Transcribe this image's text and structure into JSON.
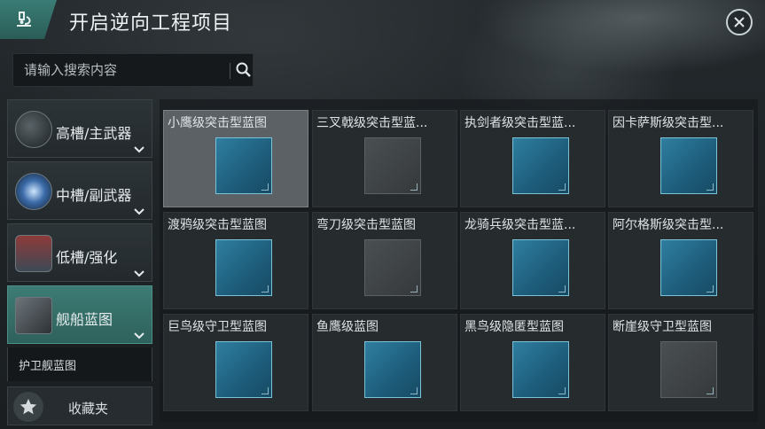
{
  "header": {
    "title": "开启逆向工程项目",
    "icon": "microscope-icon",
    "close_icon": "close-icon"
  },
  "search": {
    "placeholder": "请输入搜索内容",
    "icon": "search-icon"
  },
  "sidebar": {
    "categories": [
      {
        "label": "高槽/主武器",
        "icon": "weapon-turret-icon",
        "active": false
      },
      {
        "label": "中槽/副武器",
        "icon": "electric-orb-icon",
        "active": false
      },
      {
        "label": "低槽/强化",
        "icon": "armor-module-icon",
        "active": false
      },
      {
        "label": "舰船蓝图",
        "icon": "ship-blueprint-icon",
        "active": true
      }
    ],
    "subcategory": "护卫舰蓝图",
    "favorites": {
      "label": "收藏夹",
      "icon": "star-icon"
    }
  },
  "blueprints": [
    {
      "label": "小鹰级突击型蓝图",
      "selected": true,
      "available": true
    },
    {
      "label": "三叉戟级突击型蓝...",
      "selected": false,
      "available": false
    },
    {
      "label": "执剑者级突击型蓝...",
      "selected": false,
      "available": true
    },
    {
      "label": "因卡萨斯级突击型...",
      "selected": false,
      "available": true
    },
    {
      "label": "渡鸦级突击型蓝图",
      "selected": false,
      "available": true
    },
    {
      "label": "弯刀级突击型蓝图",
      "selected": false,
      "available": false
    },
    {
      "label": "龙骑兵级突击型蓝...",
      "selected": false,
      "available": true
    },
    {
      "label": "阿尔格斯级突击型...",
      "selected": false,
      "available": true
    },
    {
      "label": "巨鸟级守卫型蓝图",
      "selected": false,
      "available": true
    },
    {
      "label": "鱼鹰级蓝图",
      "selected": false,
      "available": true
    },
    {
      "label": "黑鸟级隐匿型蓝图",
      "selected": false,
      "available": true
    },
    {
      "label": "断崖级守卫型蓝图",
      "selected": false,
      "available": false
    }
  ],
  "colors": {
    "accent": "#3d7c75",
    "thumb_blue": "#2f7ea0",
    "thumb_gray": "#4a4f52"
  }
}
